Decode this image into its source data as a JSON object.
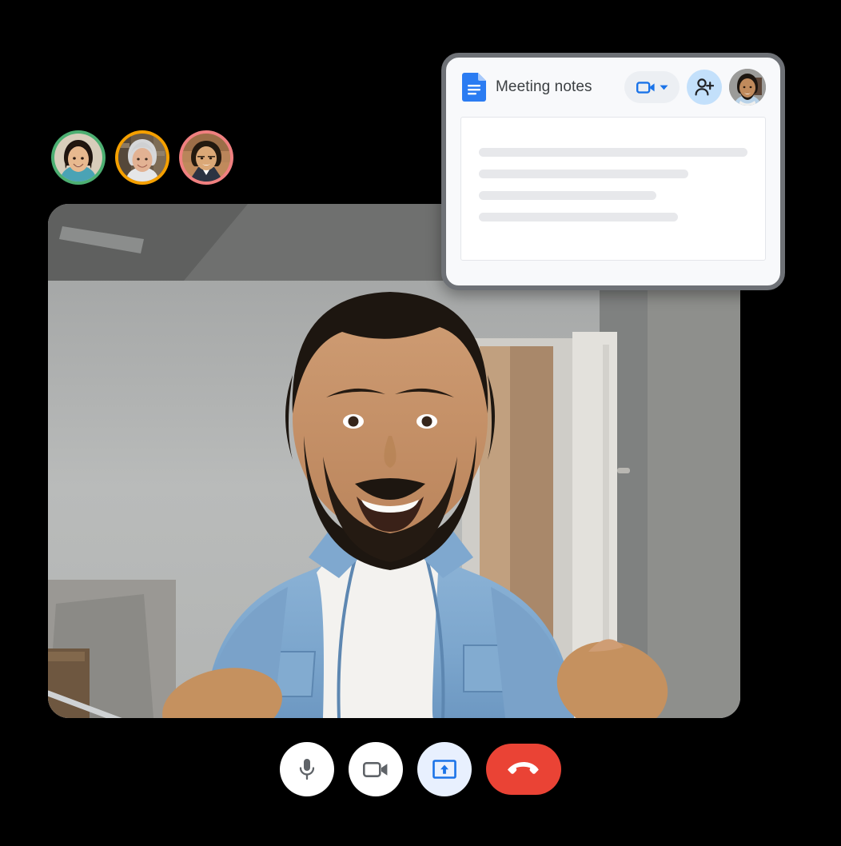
{
  "meta": {
    "background_color": "#000000",
    "accent_blue": "#1a73e8",
    "danger_red": "#ea4335"
  },
  "participants": {
    "label": "participant-thumbnails",
    "items": [
      {
        "name": "participant-1",
        "ring_color": "#4caf72",
        "icon": "avatar-woman-asian"
      },
      {
        "name": "participant-2",
        "ring_color": "#f5a000",
        "icon": "avatar-woman-senior"
      },
      {
        "name": "participant-3",
        "ring_color": "#f08080",
        "icon": "avatar-man-asian"
      }
    ]
  },
  "video": {
    "name": "main-video-tile",
    "subject": "smiling-man-denim-shirt",
    "alt": "Smiling bearded man in a denim shirt on a video call"
  },
  "notes_card": {
    "title": "Meeting notes",
    "doc_icon": "google-docs-icon",
    "header_actions": [
      {
        "name": "meet-camera-dropdown-button",
        "icon": "video-camera-icon",
        "caret": "chevron-down-icon"
      },
      {
        "name": "add-person-button",
        "icon": "person-add-icon"
      },
      {
        "name": "header-avatar",
        "icon": "avatar-man-denim"
      }
    ],
    "body_lines": [
      {
        "name": "doc-skeleton-line-1",
        "width_pct": 100
      },
      {
        "name": "doc-skeleton-line-2",
        "width_pct": 78
      },
      {
        "name": "doc-skeleton-line-3",
        "width_pct": 66
      },
      {
        "name": "doc-skeleton-line-4",
        "width_pct": 74
      }
    ]
  },
  "controls": {
    "items": [
      {
        "name": "microphone-button",
        "icon": "microphone-icon",
        "style": "white"
      },
      {
        "name": "camera-button",
        "icon": "video-camera-icon",
        "style": "white"
      },
      {
        "name": "present-screen-button",
        "icon": "present-screen-icon",
        "style": "light-blue"
      },
      {
        "name": "end-call-button",
        "icon": "phone-hangup-icon",
        "style": "red"
      }
    ]
  }
}
